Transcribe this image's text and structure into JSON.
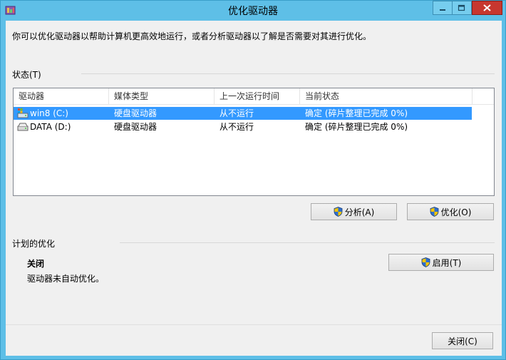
{
  "window": {
    "title": "优化驱动器"
  },
  "intro": "你可以优化驱动器以帮助计算机更高效地运行，或者分析驱动器以了解是否需要对其进行优化。",
  "status_section": {
    "label": "状态(T)"
  },
  "list": {
    "columns": [
      "驱动器",
      "媒体类型",
      "上一次运行时间",
      "当前状态"
    ],
    "rows": [
      {
        "drive": "win8 (C:)",
        "media": "硬盘驱动器",
        "last_run": "从不运行",
        "status": "确定 (碎片整理已完成 0%)",
        "icon": "os-drive-icon",
        "selected": true
      },
      {
        "drive": "DATA (D:)",
        "media": "硬盘驱动器",
        "last_run": "从不运行",
        "status": "确定 (碎片整理已完成 0%)",
        "icon": "hard-drive-icon",
        "selected": false
      }
    ]
  },
  "buttons": {
    "analyze": "分析(A)",
    "optimize": "优化(O)",
    "enable": "启用(T)",
    "close": "关闭(C)"
  },
  "schedule_section": {
    "label": "计划的优化",
    "state": "关闭",
    "description": "驱动器未自动优化。"
  },
  "colors": {
    "title_bar": "#5ebfe7",
    "selection": "#3399ff",
    "close_button": "#c7372f"
  }
}
